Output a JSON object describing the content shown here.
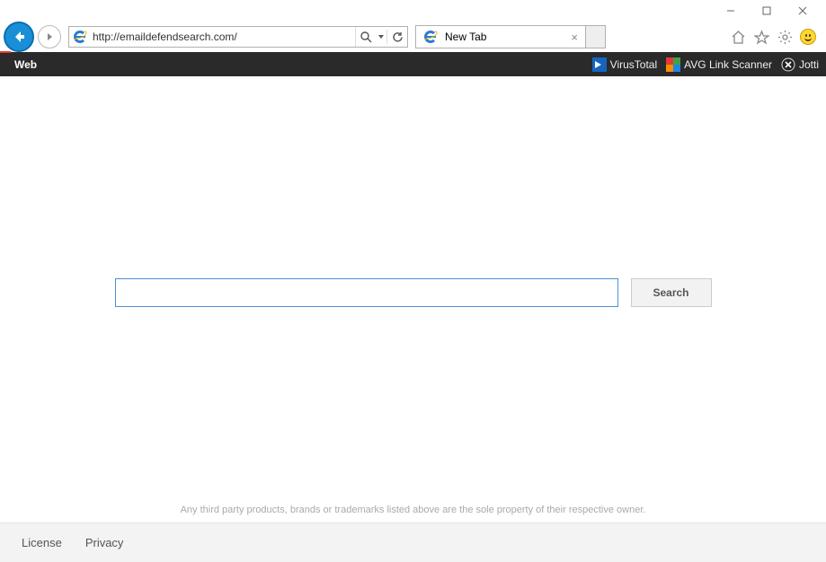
{
  "window": {
    "controls": {
      "minimize": "–",
      "maximize": "☐",
      "close": "✕"
    }
  },
  "nav": {
    "url": "http://emaildefendsearch.com/"
  },
  "tabs": [
    {
      "title": "New Tab"
    }
  ],
  "toolbar": {
    "web_label": "Web",
    "items": [
      {
        "label": "VirusTotal"
      },
      {
        "label": "AVG Link Scanner"
      },
      {
        "label": "Jotti"
      }
    ]
  },
  "page": {
    "search_placeholder": "",
    "search_button": "Search",
    "disclaimer": "Any third party products, brands or trademarks listed above are the sole property of their respective owner."
  },
  "footer": {
    "license": "License",
    "privacy": "Privacy"
  }
}
